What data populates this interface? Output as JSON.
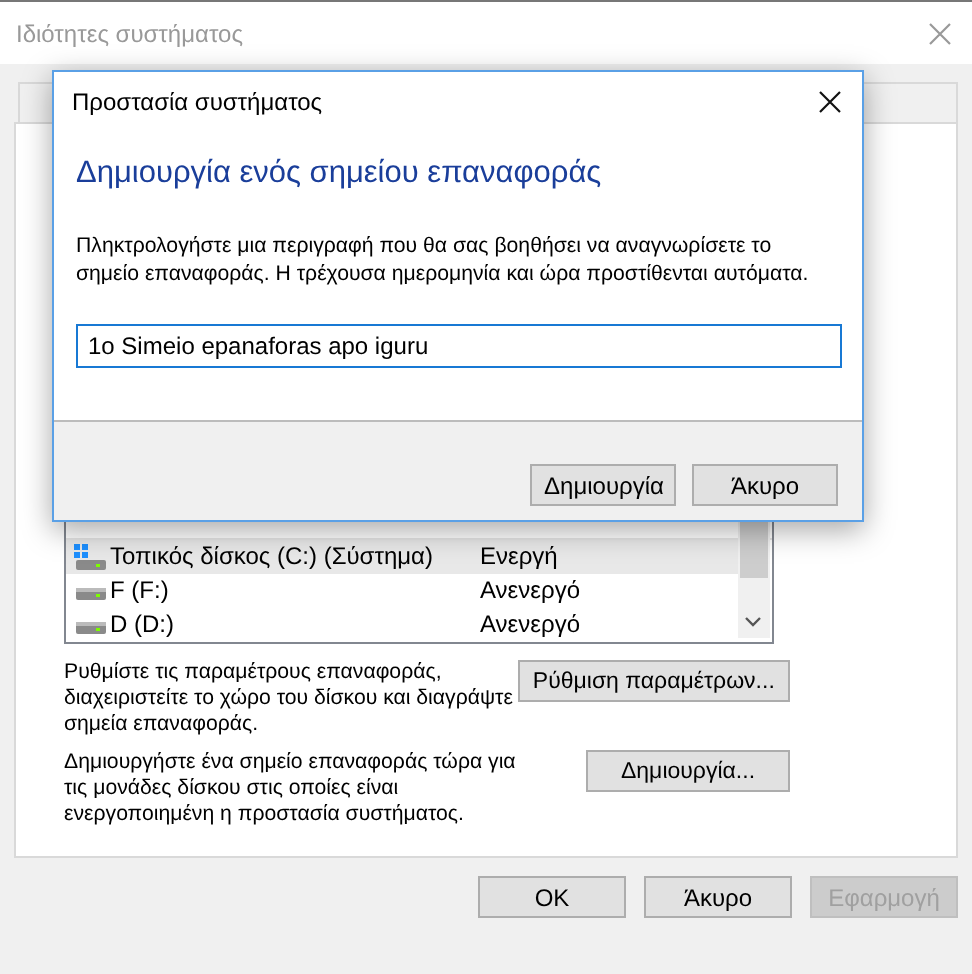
{
  "window": {
    "title": "Ιδιότητες συστήματος"
  },
  "drives": {
    "rows": [
      {
        "name": "Τοπικός δίσκος (C:) (Σύστημα)",
        "protection": "Ενεργή",
        "kind": "system",
        "selected": true
      },
      {
        "name": "F (F:)",
        "protection": "Ανενεργό",
        "kind": "drive",
        "selected": false
      },
      {
        "name": "D (D:)",
        "protection": "Ανενεργό",
        "kind": "drive",
        "selected": false
      }
    ]
  },
  "configure": {
    "text": "Ρυθμίστε τις παραμέτρους επαναφοράς, διαχειριστείτε το χώρο του δίσκου και διαγράψτε σημεία επαναφοράς.",
    "button": "Ρύθμιση παραμέτρων..."
  },
  "create": {
    "text": "Δημιουργήστε ένα σημείο επαναφοράς τώρα για τις μονάδες δίσκου στις οποίες είναι ενεργοποιημένη η προστασία συστήματος.",
    "button": "Δημιουργία..."
  },
  "buttons": [
    {
      "label": "OK",
      "disabled": false
    },
    {
      "label": "Άκυρο",
      "disabled": false
    },
    {
      "label": "Εφαρμογή",
      "disabled": true
    }
  ],
  "dialog": {
    "title": "Προστασία συστήματος",
    "heading": "Δημιουργία ενός σημείου επαναφοράς",
    "description": "Πληκτρολογήστε μια περιγραφή που θα σας βοηθήσει να αναγνωρίσετε το σημείο επαναφοράς. Η τρέχουσα ημερομηνία και ώρα προστίθενται αυτόματα.",
    "input": {
      "value": "1o Simeio epanaforas apo iguru"
    },
    "buttons": [
      "Δημιουργία",
      "Άκυρο"
    ]
  }
}
